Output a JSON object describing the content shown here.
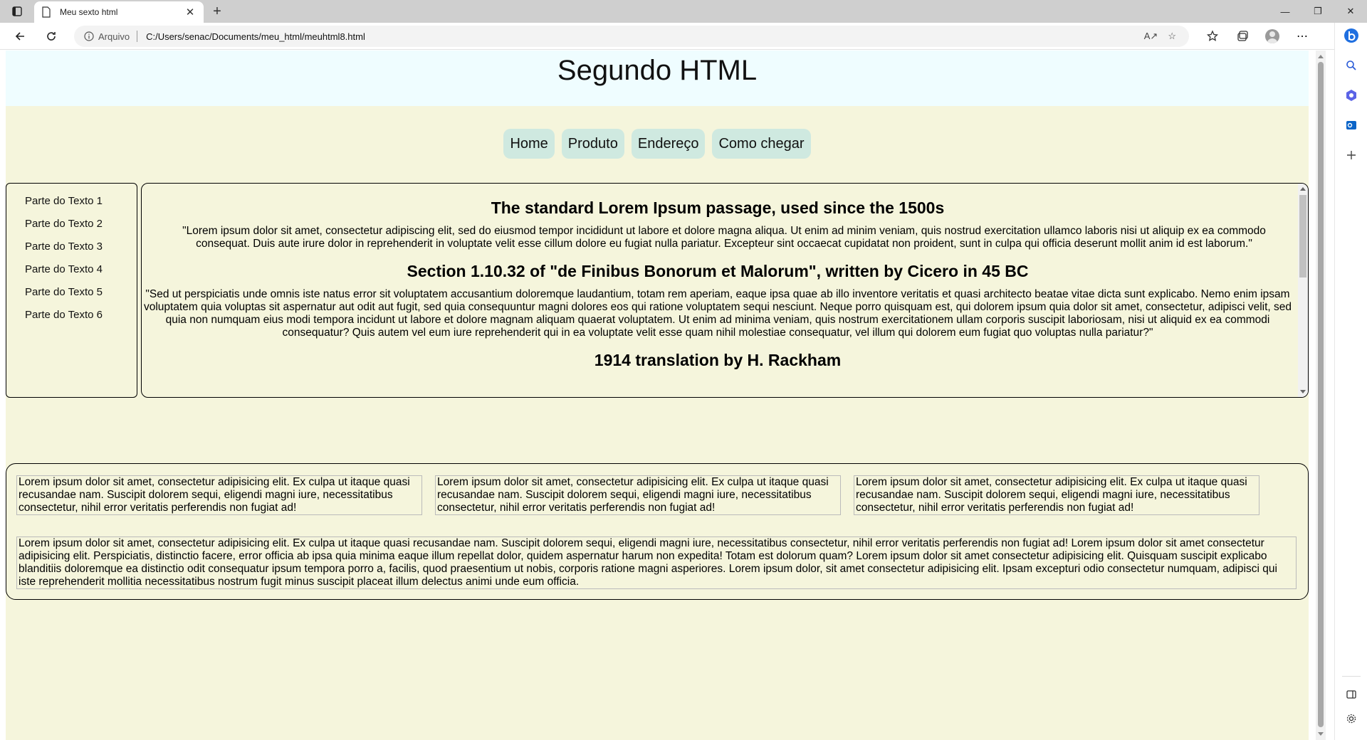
{
  "browser": {
    "tab_title": "Meu sexto html",
    "new_tab_symbol": "+",
    "close_symbol": "✕",
    "site_label": "Arquivo",
    "url": "C:/Users/senac/Documents/meu_html/meuhtml8.html",
    "read_aloud_label": "A↗"
  },
  "page": {
    "header_title": "Segundo HTML",
    "nav": [
      "Home",
      "Produto",
      "Endereço",
      "Como chegar"
    ],
    "sidebar": [
      "Parte do Texto 1",
      "Parte do Texto 2",
      "Parte do Texto 3",
      "Parte do Texto 4",
      "Parte do Texto 5",
      "Parte do Texto 6"
    ],
    "main": {
      "heading1": "The standard Lorem Ipsum passage, used since the 1500s",
      "para1": "\"Lorem ipsum dolor sit amet, consectetur adipiscing elit, sed do eiusmod tempor incididunt ut labore et dolore magna aliqua. Ut enim ad minim veniam, quis nostrud exercitation ullamco laboris nisi ut aliquip ex ea commodo consequat. Duis aute irure dolor in reprehenderit in voluptate velit esse cillum dolore eu fugiat nulla pariatur. Excepteur sint occaecat cupidatat non proident, sunt in culpa qui officia deserunt mollit anim id est laborum.\"",
      "heading2": "Section 1.10.32 of \"de Finibus Bonorum et Malorum\", written by Cicero in 45 BC",
      "para2": "\"Sed ut perspiciatis unde omnis iste natus error sit voluptatem accusantium doloremque laudantium, totam rem aperiam, eaque ipsa quae ab illo inventore veritatis et quasi architecto beatae vitae dicta sunt explicabo. Nemo enim ipsam voluptatem quia voluptas sit aspernatur aut odit aut fugit, sed quia consequuntur magni dolores eos qui ratione voluptatem sequi nesciunt. Neque porro quisquam est, qui dolorem ipsum quia dolor sit amet, consectetur, adipisci velit, sed quia non numquam eius modi tempora incidunt ut labore et dolore magnam aliquam quaerat voluptatem. Ut enim ad minima veniam, quis nostrum exercitationem ullam corporis suscipit laboriosam, nisi ut aliquid ex ea commodi consequatur? Quis autem vel eum iure reprehenderit qui in ea voluptate velit esse quam nihil molestiae consequatur, vel illum qui dolorem eum fugiat quo voluptas nulla pariatur?\"",
      "heading3": "1914 translation by H. Rackham"
    },
    "cards": [
      "Lorem ipsum dolor sit amet, consectetur adipisicing elit. Ex culpa ut itaque quasi recusandae nam. Suscipit dolorem sequi, eligendi magni iure, necessitatibus consectetur, nihil error veritatis perferendis non fugiat ad!",
      "Lorem ipsum dolor sit amet, consectetur adipisicing elit. Ex culpa ut itaque quasi recusandae nam. Suscipit dolorem sequi, eligendi magni iure, necessitatibus consectetur, nihil error veritatis perferendis non fugiat ad!",
      "Lorem ipsum dolor sit amet, consectetur adipisicing elit. Ex culpa ut itaque quasi recusandae nam. Suscipit dolorem sequi, eligendi magni iure, necessitatibus consectetur, nihil error veritatis perferendis non fugiat ad!"
    ],
    "wide_text": "Lorem ipsum dolor sit amet, consectetur adipisicing elit. Ex culpa ut itaque quasi recusandae nam. Suscipit dolorem sequi, eligendi magni iure, necessitatibus consectetur, nihil error veritatis perferendis non fugiat ad! Lorem ipsum dolor sit amet consectetur adipisicing elit. Perspiciatis, distinctio facere, error officia ab ipsa quia minima eaque illum repellat dolor, quidem aspernatur harum non expedita! Totam est dolorum quam? Lorem ipsum dolor sit amet consectetur adipisicing elit. Quisquam suscipit explicabo blanditiis doloremque ea distinctio odit consequatur ipsum tempora porro a, facilis, quod praesentium ut nobis, corporis ratione magni asperiores. Lorem ipsum dolor, sit amet consectetur adipisicing elit. Ipsam excepturi odio consectetur numquam, adipisci qui iste reprehenderit mollitia necessitatibus nostrum fugit minus suscipit placeat illum delectus animi unde eum officia."
  },
  "colors": {
    "header_bg": "#effdff",
    "body_bg": "#f5f5dc",
    "nav_bg": "#cfe9e0"
  }
}
